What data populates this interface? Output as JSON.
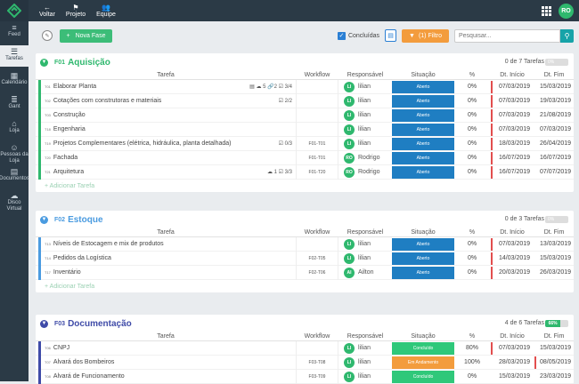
{
  "topnav": {
    "voltar": "Voltar",
    "projeto": "Projeto",
    "equipe": "Equipe",
    "avatar": "RO"
  },
  "sidebar": [
    {
      "label": "Feed",
      "icon": "≡"
    },
    {
      "label": "Tarefas",
      "icon": "☰"
    },
    {
      "label": "Calendário",
      "icon": "▦"
    },
    {
      "label": "Gant",
      "icon": "≣"
    },
    {
      "label": "Loja",
      "icon": "⌂"
    },
    {
      "label": "Pessoas da Loja",
      "icon": "☺"
    },
    {
      "label": "Documentos",
      "icon": "▤"
    },
    {
      "label": "Disco Virtual",
      "icon": "☁"
    }
  ],
  "toolbar": {
    "new_phase": "Nova Fase",
    "concluidas": "Concluídas",
    "filter": "(1) Filtro",
    "search_placeholder": "Pesquisar..."
  },
  "columns": {
    "tarefa": "Tarefa",
    "workflow": "Workflow",
    "responsavel": "Responsável",
    "situacao": "Situação",
    "pct": "%",
    "dt_inicio": "Dt. Início",
    "dt_fim": "Dt. Fim"
  },
  "add_task": "+ Adicionar Tarefa",
  "phases": [
    {
      "code": "F01",
      "name": "Aquisição",
      "count": "0 de 7 Tarefas",
      "progress": "0%",
      "color": "#2fb86e",
      "tasks": [
        {
          "id": "T01",
          "name": "Elaborar Planta",
          "meta": "▤  ☁ 5  🔗2  ☑ 3/4",
          "wf": "",
          "resp": "lilian",
          "initials": "LI",
          "status": "Aberto",
          "pct": "0%",
          "di": "07/03/2019",
          "df": "15/03/2019",
          "late_di": true,
          "late_df": false
        },
        {
          "id": "T02",
          "name": "Cotações com construtoras e materiais",
          "meta": "☑ 2/2",
          "wf": "",
          "resp": "lilian",
          "initials": "LI",
          "status": "Aberto",
          "pct": "0%",
          "di": "07/03/2019",
          "df": "19/03/2019",
          "late_di": true,
          "late_df": false
        },
        {
          "id": "T03",
          "name": "Construção",
          "meta": "",
          "wf": "",
          "resp": "lilian",
          "initials": "LI",
          "status": "Aberto",
          "pct": "0%",
          "di": "07/03/2019",
          "df": "21/08/2019",
          "late_di": true,
          "late_df": false
        },
        {
          "id": "T18",
          "name": "Engenharia",
          "meta": "",
          "wf": "",
          "resp": "lilian",
          "initials": "LI",
          "status": "Aberto",
          "pct": "0%",
          "di": "07/03/2019",
          "df": "07/03/2019",
          "late_di": true,
          "late_df": false
        },
        {
          "id": "T19",
          "name": "Projetos Complementares (elétrica, hidráulica, planta detalhada)",
          "meta": "☑ 0/3",
          "wf": "F01-T01",
          "resp": "lilian",
          "initials": "LI",
          "status": "Aberto",
          "pct": "0%",
          "di": "18/03/2019",
          "df": "26/04/2019",
          "late_di": true,
          "late_df": false
        },
        {
          "id": "T20",
          "name": "Fachada",
          "meta": "",
          "wf": "F01-T01",
          "resp": "Rodrigo",
          "initials": "RO",
          "status": "Aberto",
          "pct": "0%",
          "di": "16/07/2019",
          "df": "16/07/2019",
          "late_di": true,
          "late_df": false
        },
        {
          "id": "T21",
          "name": "Arquitetura",
          "meta": "☁ 1  ☑ 3/3",
          "wf": "F01-T20",
          "resp": "Rodrigo",
          "initials": "RO",
          "status": "Aberto",
          "pct": "0%",
          "di": "16/07/2019",
          "df": "07/07/2019",
          "late_di": true,
          "late_df": false
        }
      ]
    },
    {
      "code": "F02",
      "name": "Estoque",
      "count": "0 de 3 Tarefas",
      "progress": "0%",
      "color": "#4a9be0",
      "tasks": [
        {
          "id": "T13",
          "name": "Níveis de Estocagem e mix de produtos",
          "meta": "",
          "wf": "",
          "resp": "lilian",
          "initials": "LI",
          "status": "Aberto",
          "pct": "0%",
          "di": "07/03/2019",
          "df": "13/03/2019",
          "late_di": true,
          "late_df": false
        },
        {
          "id": "T14",
          "name": "Pedidos da Logística",
          "meta": "",
          "wf": "F02-T05",
          "resp": "lilian",
          "initials": "LI",
          "status": "Aberto",
          "pct": "0%",
          "di": "14/03/2019",
          "df": "15/03/2019",
          "late_di": true,
          "late_df": false
        },
        {
          "id": "T17",
          "name": "Inventário",
          "meta": "",
          "wf": "F02-T06",
          "resp": "Ailton",
          "initials": "AI",
          "status": "Aberto",
          "pct": "0%",
          "di": "20/03/2019",
          "df": "26/03/2019",
          "late_di": true,
          "late_df": false
        }
      ]
    },
    {
      "code": "F03",
      "name": "Documentação",
      "count": "4 de 6 Tarefas",
      "progress": "66%",
      "color": "#3f4ba8",
      "tasks": [
        {
          "id": "T06",
          "name": "CNPJ",
          "meta": "",
          "wf": "",
          "resp": "lilian",
          "initials": "LI",
          "status": "Concluído",
          "pct": "80%",
          "di": "07/03/2019",
          "df": "15/03/2019",
          "late_di": true,
          "late_df": false
        },
        {
          "id": "T07",
          "name": "Alvará dos Bombeiros",
          "meta": "",
          "wf": "F03-T08",
          "resp": "lilian",
          "initials": "LI",
          "status": "Em Andamento",
          "pct": "100%",
          "di": "28/03/2019",
          "df": "08/05/2019",
          "late_di": false,
          "late_df": true
        },
        {
          "id": "T08",
          "name": "Alvará de Funcionamento",
          "meta": "",
          "wf": "F03-T09",
          "resp": "lilian",
          "initials": "LI",
          "status": "Concluído",
          "pct": "0%",
          "di": "15/03/2019",
          "df": "23/03/2019",
          "late_di": false,
          "late_df": false
        }
      ]
    }
  ]
}
